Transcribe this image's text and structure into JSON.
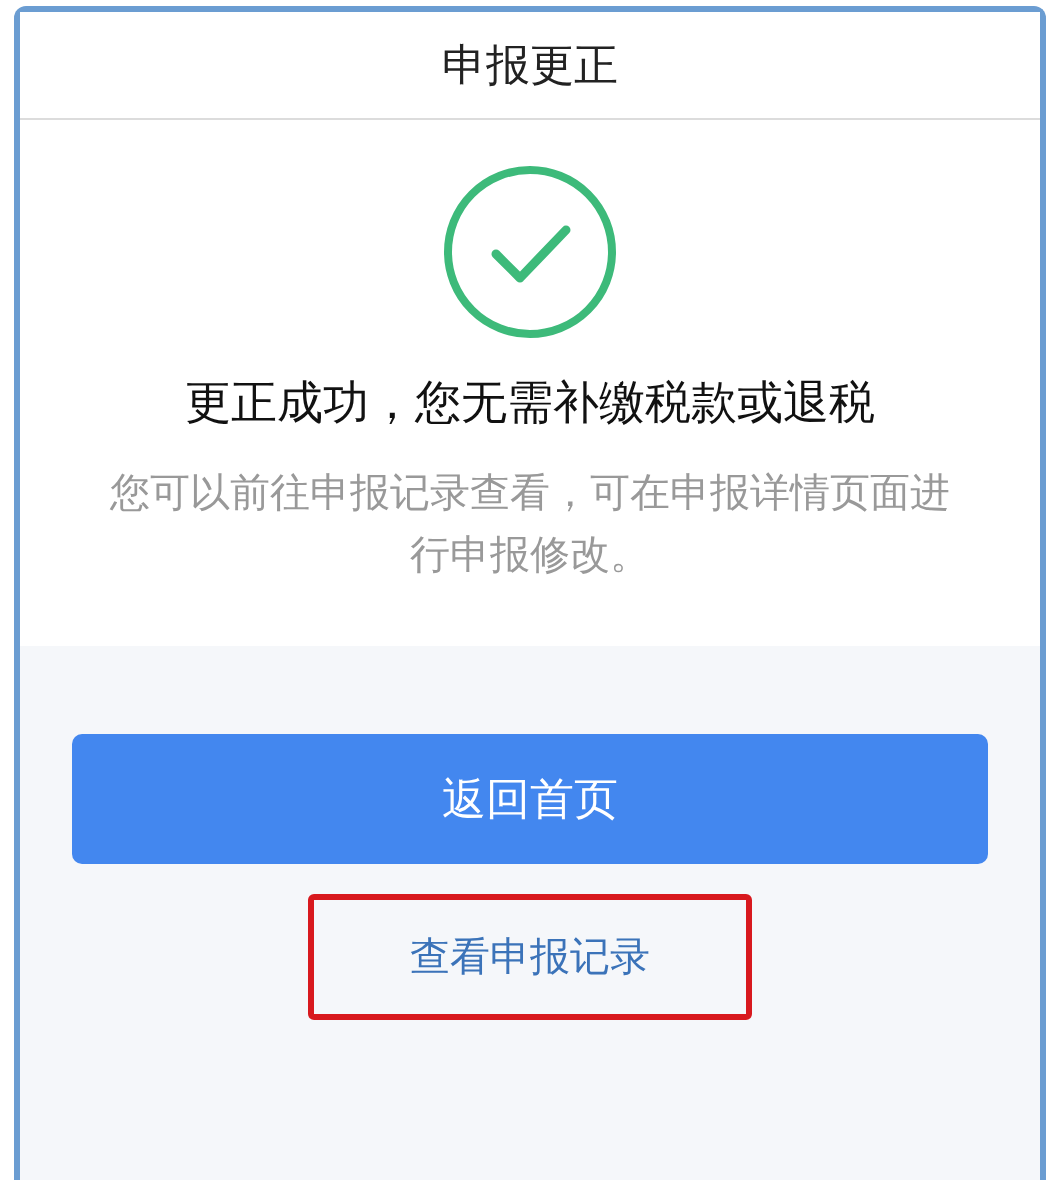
{
  "window": {
    "title": "申报更正"
  },
  "result": {
    "headline": "更正成功，您无需补缴税款或退税",
    "message": "您可以前往申报记录查看，可在申报详情页面进行申报修改。"
  },
  "actions": [
    {
      "kind": "primary",
      "label": "返回首页",
      "highlighted": false
    },
    {
      "kind": "link",
      "label": "查看申报记录",
      "highlighted": true
    }
  ]
}
